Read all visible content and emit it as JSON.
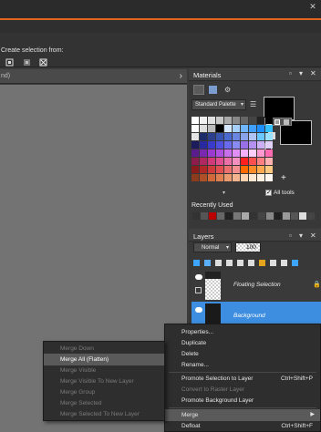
{
  "toolbar": {
    "create_selection_label": "Create selection from:"
  },
  "canvas": {
    "tab_text": "nd)"
  },
  "materials": {
    "title": "Materials",
    "palette_dropdown": "Standard Palette",
    "all_tools_label": "All tools",
    "all_tools_checked": true,
    "recently_used_label": "Recently Used",
    "foreground_color": "#000000",
    "background_color": "#000000"
  },
  "layers": {
    "title": "Layers",
    "blend_mode": "Normal",
    "opacity": "100",
    "items": [
      {
        "name": "Floating Selection",
        "selected": false
      },
      {
        "name": "Background",
        "selected": true
      }
    ]
  },
  "context_menu": {
    "items": [
      {
        "label": "Properties...",
        "shortcut": "",
        "enabled": true
      },
      {
        "label": "Duplicate",
        "shortcut": "",
        "enabled": true
      },
      {
        "label": "Delete",
        "shortcut": "",
        "enabled": true
      },
      {
        "label": "Rename...",
        "shortcut": "",
        "enabled": true
      },
      {
        "label": "Promote Selection to Layer",
        "shortcut": "Ctrl+Shift+P",
        "enabled": true
      },
      {
        "label": "Convert to Raster Layer",
        "shortcut": "",
        "enabled": false
      },
      {
        "label": "Promote Background Layer",
        "shortcut": "",
        "enabled": true
      },
      {
        "label": "Merge",
        "shortcut": "",
        "enabled": true,
        "highlighted": true,
        "has_submenu": true
      },
      {
        "label": "Defloat",
        "shortcut": "Ctrl+Shift+F",
        "enabled": true
      }
    ]
  },
  "merge_submenu": {
    "items": [
      {
        "label": "Merge Down",
        "enabled": false
      },
      {
        "label": "Merge All (Flatten)",
        "enabled": true,
        "highlighted": true
      },
      {
        "label": "Merge Visible",
        "enabled": false
      },
      {
        "label": "Merge Visible To New Layer",
        "enabled": false
      },
      {
        "label": "Merge Group",
        "enabled": false
      },
      {
        "label": "Merge Selected",
        "enabled": false
      },
      {
        "label": "Merge Selected To New Layer",
        "enabled": false
      }
    ]
  },
  "colors": {
    "accent_orange": "#e2641e",
    "selection_blue": "#3d8ee0",
    "menu_highlight": "#5a5a5a"
  }
}
